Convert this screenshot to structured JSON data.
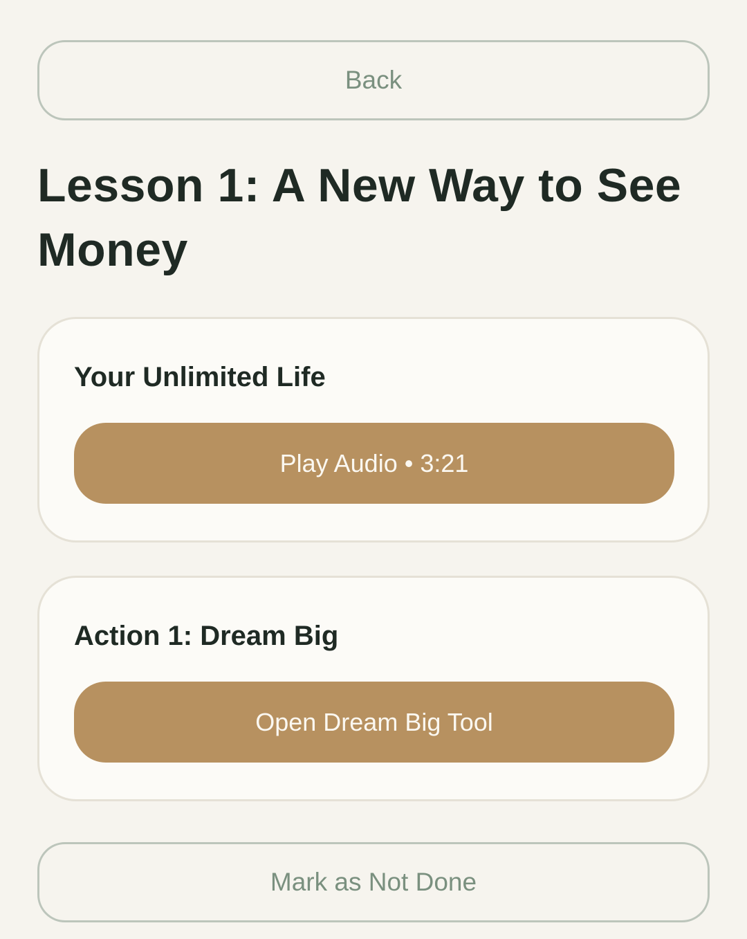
{
  "nav": {
    "back_label": "Back"
  },
  "lesson": {
    "title": "Lesson 1: A New Way to See Money"
  },
  "cards": [
    {
      "title": "Your Unlimited Life",
      "button_label": "Play Audio • 3:21"
    },
    {
      "title": "Action 1: Dream Big",
      "button_label": "Open Dream Big Tool"
    }
  ],
  "footer": {
    "mark_label": "Mark as Not Done"
  },
  "colors": {
    "background": "#f6f4ee",
    "accent": "#b79160",
    "outline": "#bcc5bb",
    "outline_text": "#7a907f",
    "heading": "#1f2a24"
  }
}
